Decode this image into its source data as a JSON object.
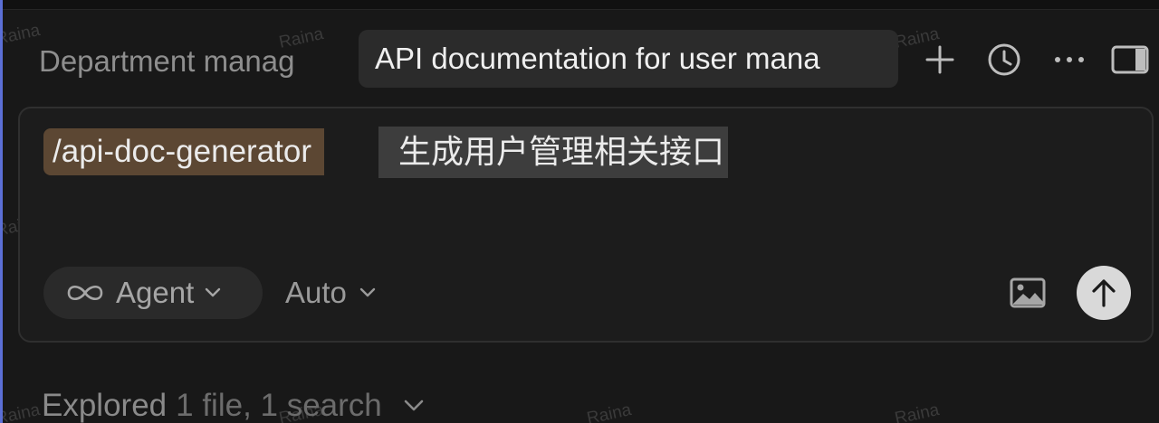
{
  "tabs": {
    "inactive_label": "Department manag",
    "active_label": "API documentation for user mana"
  },
  "toolbar_icons": [
    "plus-icon",
    "history-clock-icon",
    "more-dots-icon",
    "sidebar-toggle-icon"
  ],
  "composer": {
    "command": "/api-doc-generator",
    "prompt": "生成用户管理相关接口",
    "mode_label": "Agent",
    "model_label": "Auto"
  },
  "activity": {
    "explored_label": "Explored",
    "explored_detail": "1 file, 1 search"
  },
  "watermark_text": "Raina",
  "colors": {
    "background": "#181818",
    "command_chip": "#5c4733",
    "send_button": "#d9d9d9",
    "active_tab": "#2b2b2b"
  }
}
